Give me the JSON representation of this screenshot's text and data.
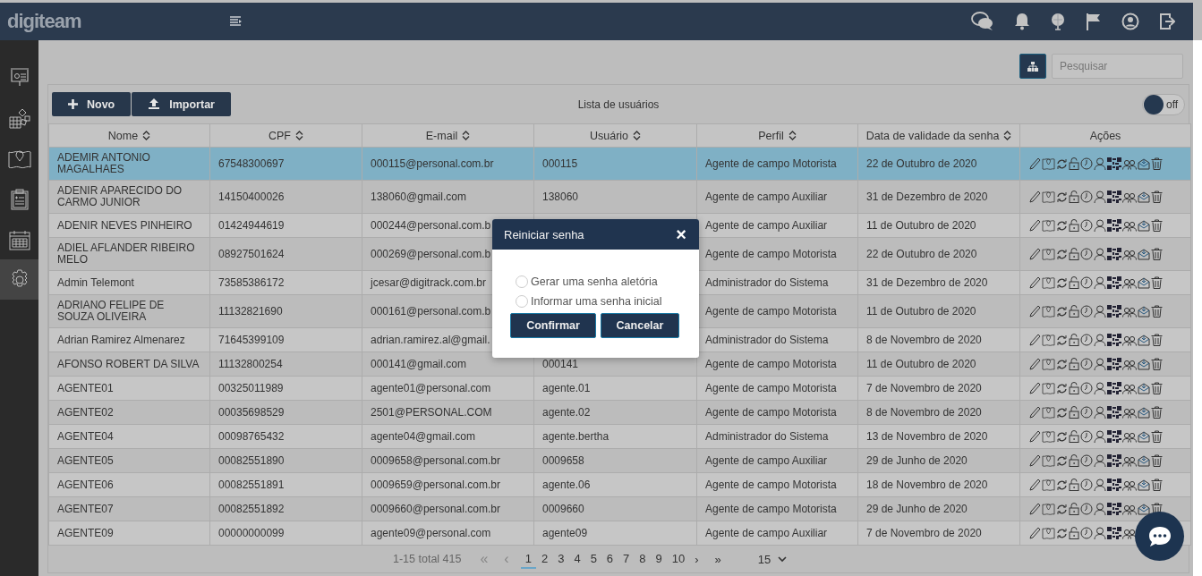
{
  "header": {
    "logo": "digiteam"
  },
  "sidebar": {
    "items": [
      {
        "selected": false
      },
      {
        "selected": false
      },
      {
        "selected": false
      },
      {
        "selected": false
      },
      {
        "selected": false
      },
      {
        "selected": true
      }
    ]
  },
  "search": {
    "placeholder": "Pesquisar"
  },
  "toolbar": {
    "buttons": [
      {
        "kind": "add",
        "label": "Novo"
      },
      {
        "kind": "import",
        "label": "Importar"
      }
    ],
    "title": "Lista de usuários",
    "toggle": {
      "on": false,
      "label": "off"
    }
  },
  "table": {
    "columns": [
      "Nome",
      "CPF",
      "E-mail",
      "Usuário",
      "Perfil",
      "Data de validade da senha",
      "Ações"
    ],
    "sortable": [
      true,
      true,
      true,
      true,
      true,
      true,
      false
    ],
    "rows": [
      {
        "selected": true,
        "cells": [
          "ADEMIR ANTONIO MAGALHAES",
          "67548300697",
          "000115@personal.com.br",
          "000115",
          "Agente de campo Motorista",
          "22 de Outubro de 2020"
        ]
      },
      {
        "selected": false,
        "cells": [
          "ADENIR APARECIDO DO CARMO JUNIOR",
          "14150400026",
          "138060@gmail.com",
          "138060",
          "Agente de campo Auxiliar",
          "31 de Dezembro de 2020"
        ]
      },
      {
        "selected": false,
        "cells": [
          "ADENIR NEVES PINHEIRO",
          "01424944619",
          "000244@personal.com.b",
          "",
          "Agente de campo Auxiliar",
          "11 de Outubro de 2020"
        ]
      },
      {
        "selected": false,
        "cells": [
          "ADIEL AFLANDER RIBEIRO MELO",
          "08927501624",
          "000269@personal.com.b",
          "",
          "Agente de campo Motorista",
          "22 de Outubro de 2020"
        ]
      },
      {
        "selected": false,
        "cells": [
          "Admin Telemont",
          "73585386172",
          "jcesar@digitrack.com.br",
          "",
          "Administrador do Sistema",
          "31 de Dezembro de 2020"
        ]
      },
      {
        "selected": false,
        "cells": [
          "ADRIANO FELIPE DE SOUZA OLIVEIRA",
          "11132821690",
          "000161@personal.com.b",
          "",
          "Agente de campo Motorista",
          "11 de Outubro de 2020"
        ]
      },
      {
        "selected": false,
        "cells": [
          "Adrian Ramirez Almenarez",
          "71645399109",
          "adrian.ramirez.al@gmail.",
          "",
          "Administrador do Sistema",
          "8 de Novembro de 2020"
        ]
      },
      {
        "selected": false,
        "cells": [
          "AFONSO ROBERT DA SILVA",
          "11132800254",
          "000141@gmail.com",
          "000141",
          "Agente de campo Motorista",
          "11 de Outubro de 2020"
        ]
      },
      {
        "selected": false,
        "cells": [
          "AGENTE01",
          "00325011989",
          "agente01@personal.com",
          "agente.01",
          "Agente de campo Motorista",
          "7 de Novembro de 2020"
        ]
      },
      {
        "selected": false,
        "cells": [
          "AGENTE02",
          "00035698529",
          "2501@PERSONAL.COM",
          "agente.02",
          "Agente de campo Motorista",
          "8 de Novembro de 2020"
        ]
      },
      {
        "selected": false,
        "cells": [
          "AGENTE04",
          "00098765432",
          "agente04@gmail.com",
          "agente.bertha",
          "Administrador do Sistema",
          "13 de Novembro de 2020"
        ]
      },
      {
        "selected": false,
        "cells": [
          "AGENTE05",
          "00082551890",
          "0009658@personal.com.br",
          "0009658",
          "Agente de campo Auxiliar",
          "29 de Junho de 2020"
        ]
      },
      {
        "selected": false,
        "cells": [
          "AGENTE06",
          "00082551891",
          "0009659@personal.com.br",
          "agente.06",
          "Agente de campo Motorista",
          "18 de Novembro de 2020"
        ]
      },
      {
        "selected": false,
        "cells": [
          "AGENTE07",
          "00082551892",
          "0009660@personal.com.br",
          "0009660",
          "Agente de campo Motorista",
          "29 de Junho de 2020"
        ]
      },
      {
        "selected": false,
        "cells": [
          "AGENTE09",
          "00000000099",
          "agente09@personal.com",
          "agente09",
          "Agente de campo Auxiliar",
          "7 de Novembro de 2020"
        ]
      }
    ]
  },
  "pagination": {
    "summary": "1-15 total 415",
    "first": "«",
    "prev": "‹",
    "pages": [
      {
        "label": "1",
        "selected": true
      },
      {
        "label": "2",
        "selected": false
      },
      {
        "label": "3",
        "selected": false
      },
      {
        "label": "4",
        "selected": false
      },
      {
        "label": "5",
        "selected": false
      },
      {
        "label": "6",
        "selected": false
      },
      {
        "label": "7",
        "selected": false
      },
      {
        "label": "8",
        "selected": false
      },
      {
        "label": "9",
        "selected": false
      },
      {
        "label": "10",
        "selected": false
      }
    ],
    "next": "›",
    "last": "»",
    "page_size": "15"
  },
  "dialog": {
    "title": "Reiniciar senha",
    "close": "×",
    "options": [
      {
        "label": "Gerar uma senha aletória",
        "selected": false
      },
      {
        "label": "Informar uma senha inicial",
        "selected": false
      }
    ],
    "buttons": [
      "Confirmar",
      "Cancelar"
    ]
  }
}
